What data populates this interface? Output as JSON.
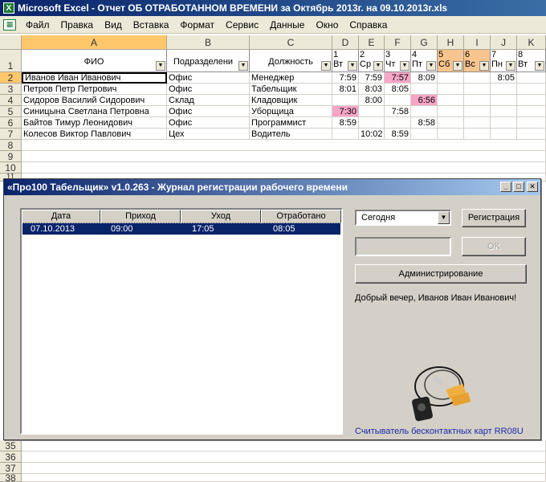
{
  "excel": {
    "title": "Microsoft Excel - Отчет ОБ ОТРАБОТАННОМ ВРЕМЕНИ за Октябрь 2013г. на 09.10.2013г.xls",
    "menu": [
      "Файл",
      "Правка",
      "Вид",
      "Вставка",
      "Формат",
      "Сервис",
      "Данные",
      "Окно",
      "Справка"
    ],
    "columns": [
      "A",
      "B",
      "C",
      "D",
      "E",
      "F",
      "G",
      "H",
      "I",
      "J",
      "K"
    ],
    "row_numbers": [
      "1",
      "2",
      "3",
      "4",
      "5",
      "6",
      "7",
      "8",
      "9",
      "10",
      "11"
    ],
    "bottom_rows": [
      "35",
      "36",
      "37",
      "38"
    ],
    "header": {
      "fio": "ФИО",
      "dept": "Подразделени",
      "position": "Должность",
      "days": [
        {
          "num": "1",
          "dow": "Вт"
        },
        {
          "num": "2",
          "dow": "Ср"
        },
        {
          "num": "3",
          "dow": "Чт"
        },
        {
          "num": "4",
          "dow": "Пт"
        },
        {
          "num": "5",
          "dow": "Сб"
        },
        {
          "num": "6",
          "dow": "Вс"
        },
        {
          "num": "7",
          "dow": "Пн"
        },
        {
          "num": "8",
          "dow": "Вт"
        }
      ]
    },
    "rows": [
      {
        "fio": "Иванов Иван Иванович",
        "dept": "Офис",
        "position": "Менеджер",
        "d1": "7:59",
        "d2": "7:59",
        "d3": "7:57",
        "d4": "8:09",
        "d7": "8:05"
      },
      {
        "fio": "Петров Петр Петрович",
        "dept": "Офис",
        "position": "Табельщик",
        "d1": "8:01",
        "d2": "8:03",
        "d3": "8:05",
        "d4": "",
        "d7": ""
      },
      {
        "fio": "Сидоров Василий Сидорович",
        "dept": "Склад",
        "position": "Кладовщик",
        "d1": "",
        "d2": "8:00",
        "d3": "",
        "d4": "6:56",
        "d7": ""
      },
      {
        "fio": "Синицына Светлана Петровна",
        "dept": "Офис",
        "position": "Уборщица",
        "d1": "7:30",
        "d2": "",
        "d3": "7:58",
        "d4": "",
        "d7": ""
      },
      {
        "fio": "Байтов Тимур Леонидович",
        "dept": "Офис",
        "position": "Программист",
        "d1": "8:59",
        "d2": "",
        "d3": "",
        "d4": "8:58",
        "d7": ""
      },
      {
        "fio": "Колесов Виктор Павлович",
        "dept": "Цех",
        "position": "Водитель",
        "d1": "",
        "d2": "10:02",
        "d3": "8:59",
        "d4": "",
        "d7": ""
      }
    ]
  },
  "dialog": {
    "title": "«Про100 Табельщик» v1.0.263 - Журнал регистрации рабочего времени",
    "list_headers": [
      "Дата",
      "Приход",
      "Уход",
      "Отработано"
    ],
    "entry": {
      "date": "07.10.2013",
      "in": "09:00",
      "out": "17:05",
      "worked": "08:05"
    },
    "period_select": "Сегодня",
    "register_label": "Регистрация",
    "ok_label": "OK",
    "admin_label": "Администрирование",
    "greeting": "Добрый вечер, Иванов Иван Иванович!",
    "reader_label": "Считыватель бесконтактных карт RR08U"
  },
  "colors": {
    "title_bar": "#0a246a",
    "highlight": "#f7a6c8",
    "weekend": "#f9c58e",
    "selection": "#0a246a"
  }
}
